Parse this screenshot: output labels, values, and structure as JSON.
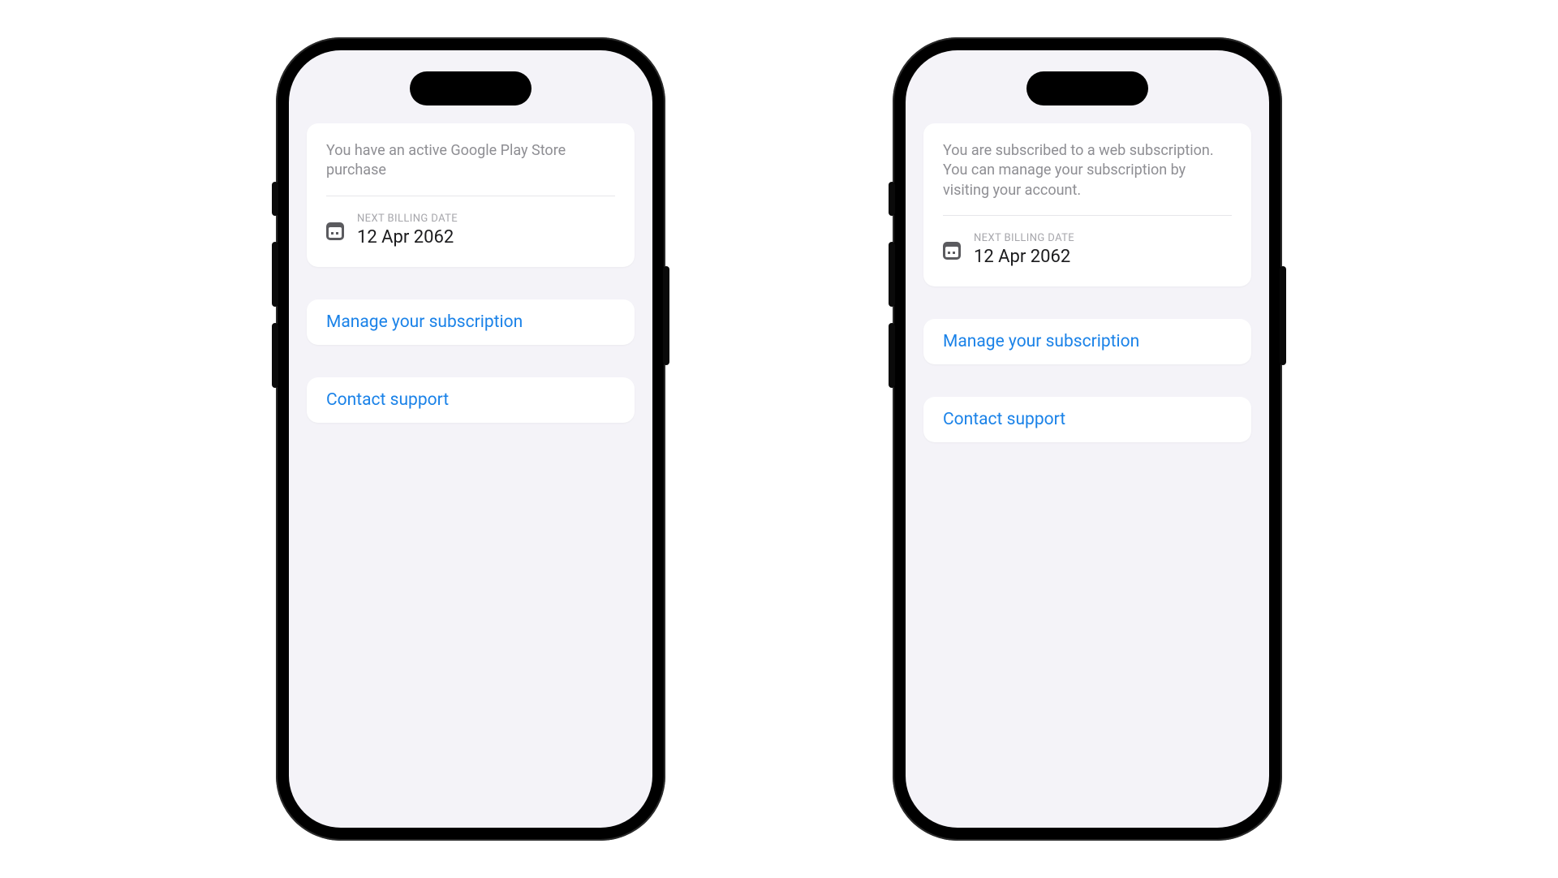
{
  "phones": [
    {
      "info_text": "You have an active Google Play Store purchase",
      "billing_label": "NEXT BILLING DATE",
      "billing_date": "12 Apr 2062",
      "manage_label": "Manage your subscription",
      "support_label": "Contact support"
    },
    {
      "info_text": "You are subscribed to a web subscription. You can manage your subscription by visiting your account.",
      "billing_label": "NEXT BILLING DATE",
      "billing_date": "12 Apr 2062",
      "manage_label": "Manage your subscription",
      "support_label": "Contact support"
    }
  ],
  "colors": {
    "link": "#1a82e8",
    "screen_bg": "#f4f3f8",
    "card_bg": "#ffffff",
    "muted_text": "#8e8e93"
  }
}
